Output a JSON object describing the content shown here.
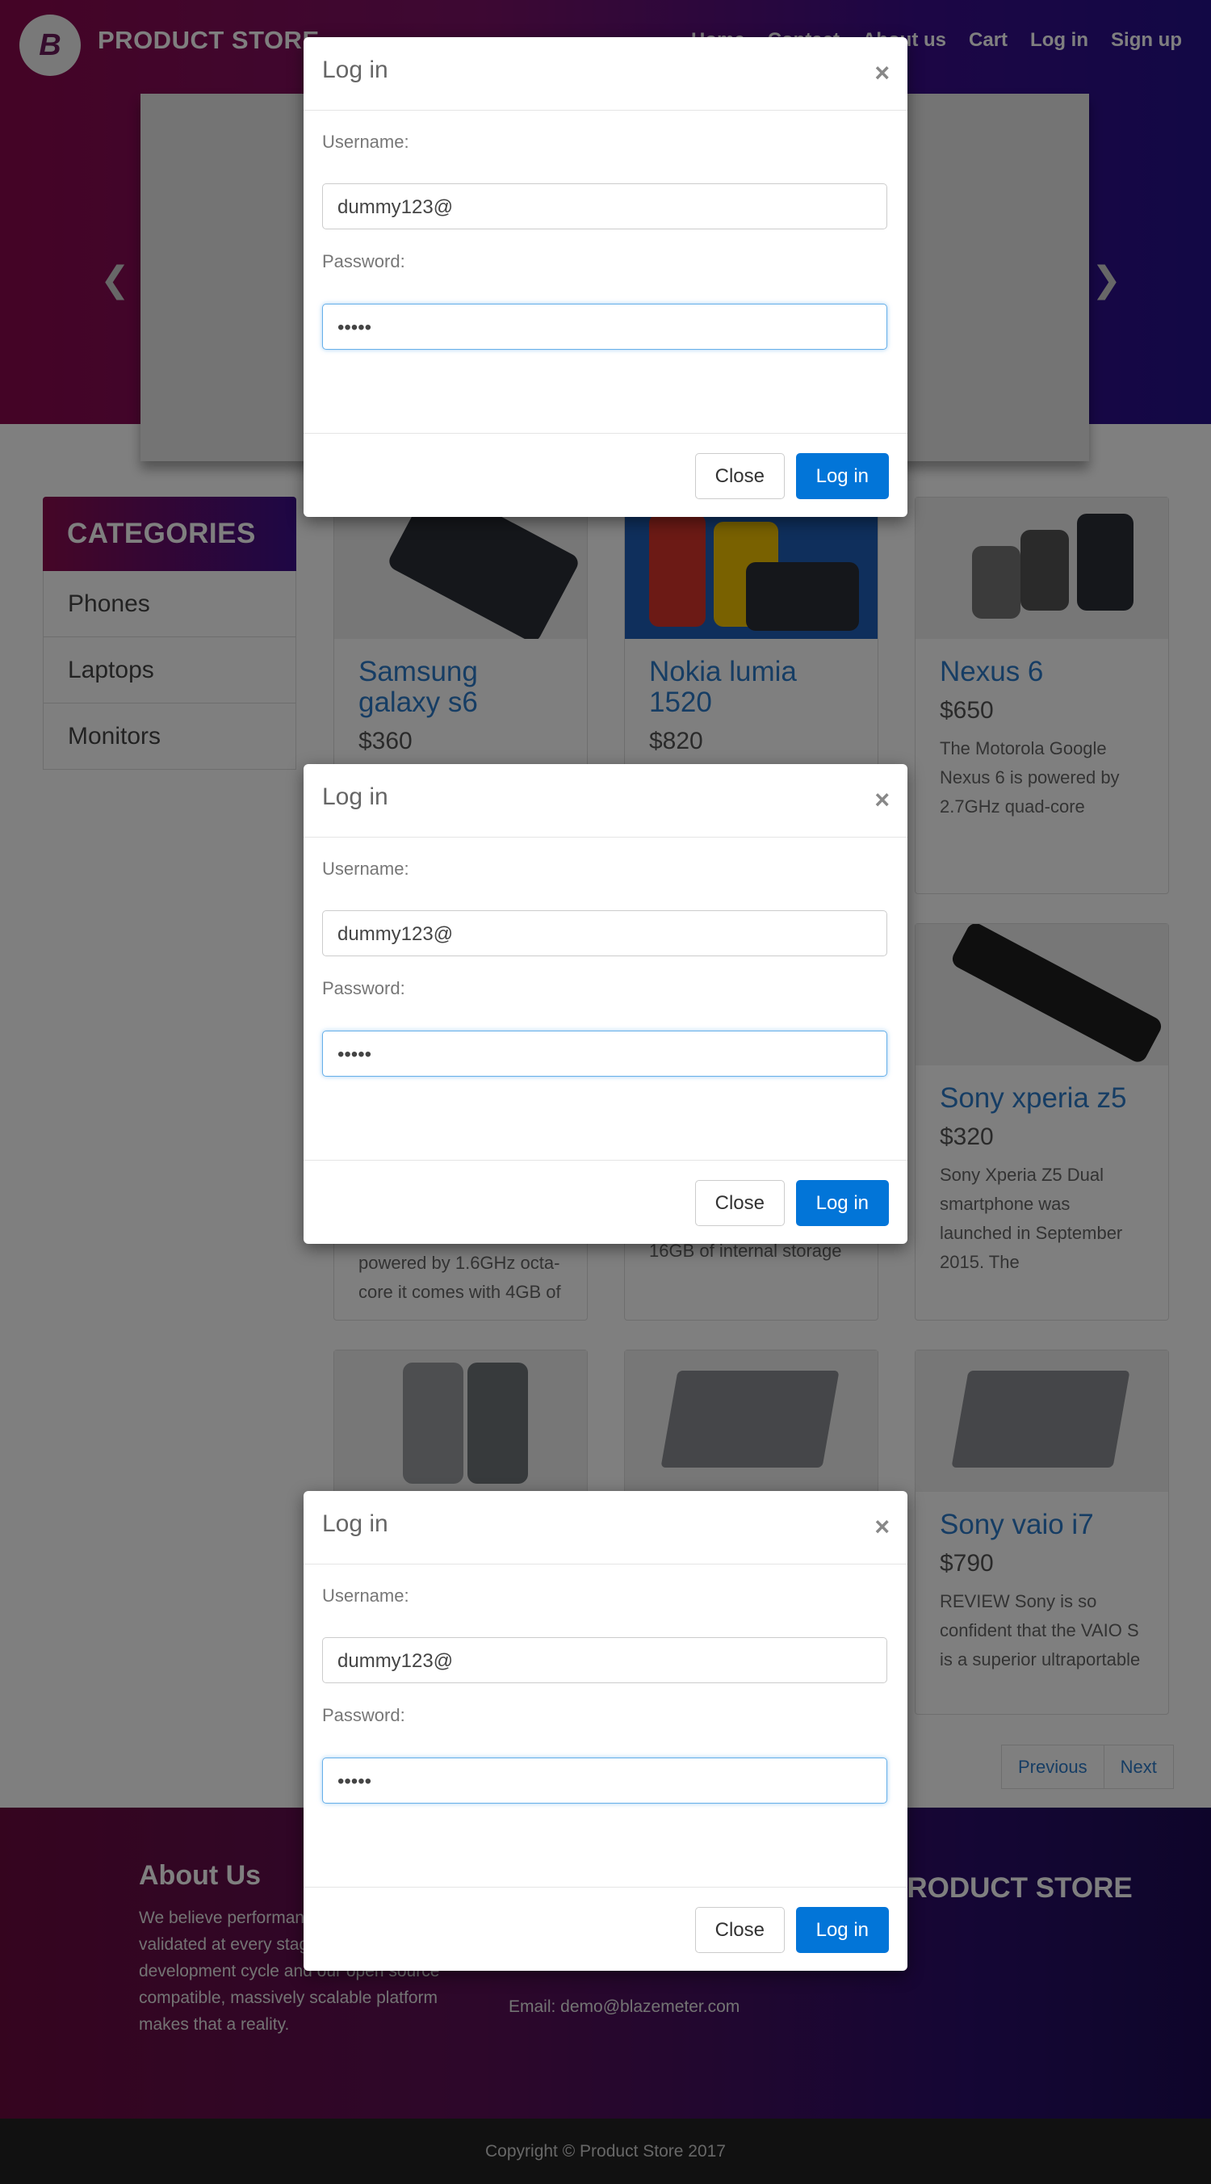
{
  "nav": {
    "brand": "PRODUCT STORE",
    "logo_letter": "B",
    "links": [
      "Home",
      "Contact",
      "About us",
      "Cart",
      "Log in",
      "Sign up"
    ]
  },
  "sidebar": {
    "title": "CATEGORIES",
    "items": [
      "Phones",
      "Laptops",
      "Monitors"
    ]
  },
  "products": [
    {
      "name": "Samsung galaxy s6",
      "price": "$360",
      "desc": ""
    },
    {
      "name": "Nokia lumia 1520",
      "price": "$820",
      "desc": ""
    },
    {
      "name": "Nexus 6",
      "price": "$650",
      "desc": "The Motorola Google Nexus 6 is powered by 2.7GHz quad-core"
    },
    {
      "name": "Sony xperia z5",
      "price": "$320",
      "desc": "Sony Xperia Z5 Dual smartphone was launched in September 2015. The"
    },
    {
      "name": "",
      "price": "",
      "desc": "powered by 1.6GHz octa-core it comes with 4GB of"
    },
    {
      "name": "",
      "price": "",
      "desc": "16GB of internal storage"
    },
    {
      "name": "Sony vaio i7",
      "price": "$790",
      "desc": "REVIEW Sony is so confident that the VAIO S is a superior ultraportable"
    }
  ],
  "pager": {
    "previous": "Previous",
    "next": "Next"
  },
  "footer": {
    "about_title": "About Us",
    "about_text": "We believe performance needs to be validated at every stage of the software development cycle and our open source compatible, massively scalable platform makes that a reality.",
    "email": "Email: demo@blazemeter.com",
    "brand": "PRODUCT STORE",
    "copyright": "Copyright © Product Store 2017"
  },
  "login_modal": {
    "title": "Log in",
    "close_glyph": "×",
    "username_label": "Username:",
    "username_value": "dummy123@",
    "password_label": "Password:",
    "password_value": "•••••",
    "close_button": "Close",
    "login_button": "Log in"
  }
}
